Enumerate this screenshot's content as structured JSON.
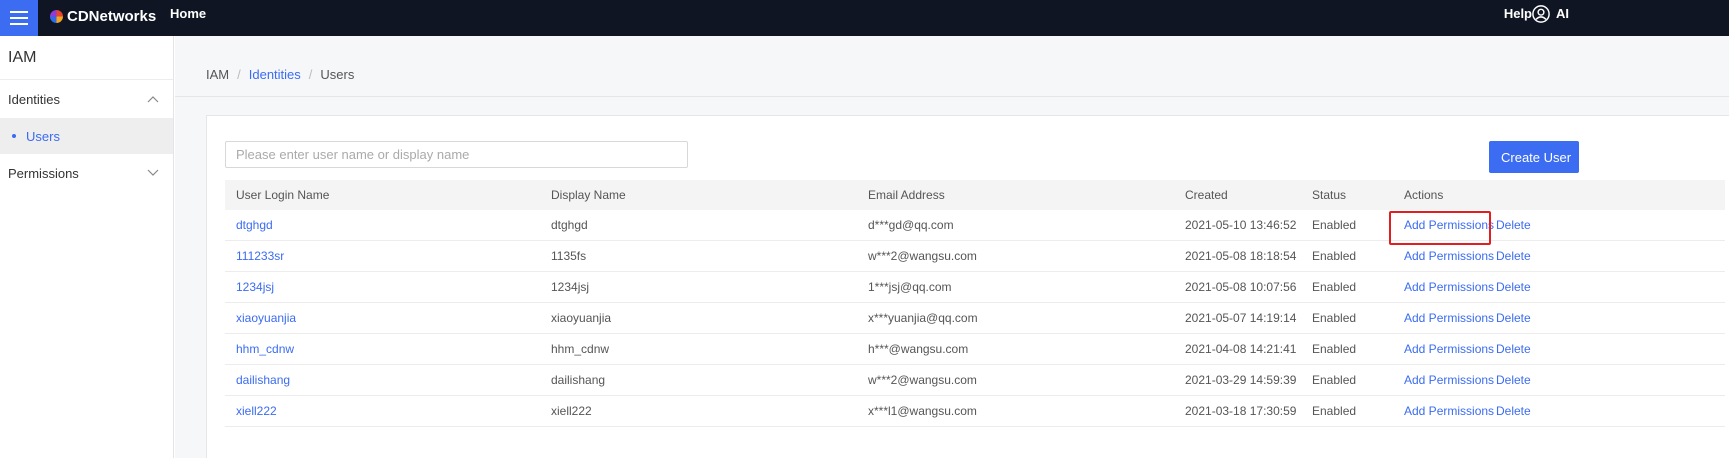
{
  "topbar": {
    "brand": "CDNetworks",
    "home": "Home",
    "help": "Help",
    "user": "AI"
  },
  "sidebar": {
    "title": "IAM",
    "groups": [
      {
        "label": "Identities",
        "expanded": true,
        "items": [
          {
            "label": "Users",
            "active": true
          }
        ]
      },
      {
        "label": "Permissions",
        "expanded": false
      }
    ]
  },
  "breadcrumb": {
    "root": "IAM",
    "parent": "Identities",
    "current": "Users",
    "separator": "/"
  },
  "search": {
    "placeholder": "Please enter user name or display name",
    "value": ""
  },
  "create_button": "Create User",
  "table": {
    "headers": [
      "User Login Name",
      "Display Name",
      "Email Address",
      "Created",
      "Status",
      "Actions"
    ],
    "rows": [
      {
        "login": "dtghgd",
        "display": "dtghgd",
        "email": "d***gd@qq.com",
        "created": "2021-05-10 13:46:52",
        "status": "Enabled"
      },
      {
        "login": "111233sr",
        "display": "1135fs",
        "email": "w***2@wangsu.com",
        "created": "2021-05-08 18:18:54",
        "status": "Enabled"
      },
      {
        "login": "1234jsj",
        "display": "1234jsj",
        "email": "1***jsj@qq.com",
        "created": "2021-05-08 10:07:56",
        "status": "Enabled"
      },
      {
        "login": "xiaoyuanjia",
        "display": "xiaoyuanjia",
        "email": "x***yuanjia@qq.com",
        "created": "2021-05-07 14:19:14",
        "status": "Enabled"
      },
      {
        "login": "hhm_cdnw",
        "display": "hhm_cdnw",
        "email": "h***@wangsu.com",
        "created": "2021-04-08 14:21:41",
        "status": "Enabled"
      },
      {
        "login": "dailishang",
        "display": "dailishang",
        "email": "w***2@wangsu.com",
        "created": "2021-03-29 14:59:39",
        "status": "Enabled"
      },
      {
        "login": "xiell222",
        "display": "xiell222",
        "email": "x***l1@wangsu.com",
        "created": "2021-03-18 17:30:59",
        "status": "Enabled"
      }
    ],
    "actions": {
      "add_permissions": "Add Permissions",
      "delete": "Delete"
    }
  },
  "colors": {
    "accent": "#3b6cf2",
    "topbar": "#0f1523",
    "highlight": "#e02020"
  }
}
